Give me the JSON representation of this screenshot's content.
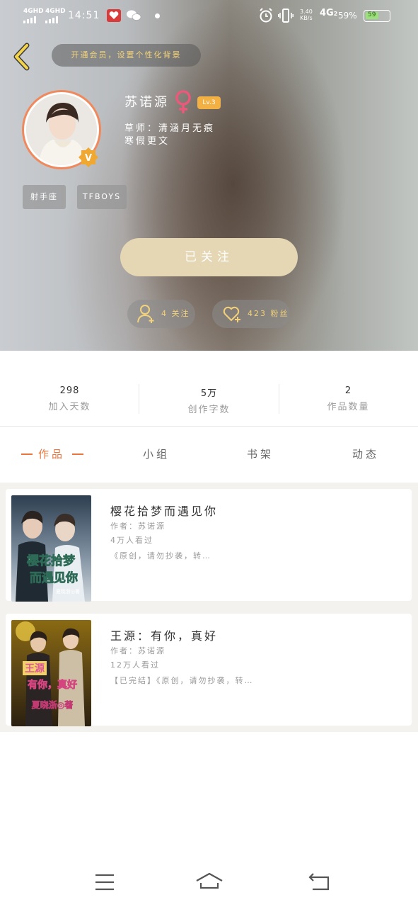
{
  "status_bar": {
    "signal_1": "4GHD",
    "signal_2": "4GHD",
    "time": "14:51",
    "speed_top": "3.40",
    "speed_bottom": "KB/s",
    "network": "4G",
    "network_sub": "2",
    "battery": "59%",
    "battery_level": 0.59,
    "battery_icon_text": "59"
  },
  "header": {
    "vip_banner": "开通会员，设置个性化背景"
  },
  "profile": {
    "name": "苏诺源",
    "level": "Lv.3",
    "bio_line1": "草师：清涵月无痕",
    "bio_line2": "寒假更文",
    "badge_letter": "V",
    "tags": [
      "射手座",
      "TFBOYS"
    ],
    "follow_button": "已关注",
    "following": "4 关注",
    "fans": "423 粉丝"
  },
  "stats": [
    {
      "value": "298",
      "label": "加入天数"
    },
    {
      "value": "5万",
      "label": "创作字数"
    },
    {
      "value": "2",
      "label": "作品数量"
    }
  ],
  "tabs": [
    "作品",
    "小组",
    "书架",
    "动态"
  ],
  "works": [
    {
      "title": "樱花拾梦而遇见你",
      "author": "作者：苏诺源",
      "views": "4万人看过",
      "desc": "《原创，请勿抄袭，转…",
      "cover_text_1": "樱花拾梦",
      "cover_text_2": "而遇见你",
      "cover_author": "夏晓浙◎著"
    },
    {
      "title": "王源：有你，真好",
      "author": "作者：苏诺源",
      "views": "12万人看过",
      "desc": "【已完结】《原创，请勿抄袭，转…",
      "cover_text_1": "王源",
      "cover_text_2": "有你，真好",
      "cover_author": "夏晓浙◎著"
    }
  ],
  "colors": {
    "accent": "#e8763e",
    "gold": "#f2d27a",
    "follow_bg": "#e5d7b4",
    "level_bg": "#f3b043",
    "female": "#e8597a"
  }
}
